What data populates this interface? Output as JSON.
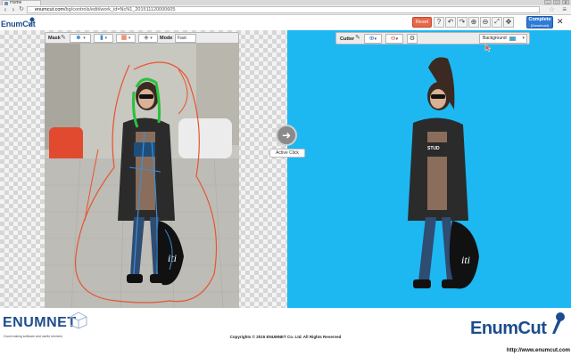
{
  "browser": {
    "tab_title": "Home",
    "url_host": "enumcut.com",
    "url_path": "/bg/controls/edit/work_id=NcN1_201511120000605",
    "window_buttons": [
      "–",
      "□",
      "✕"
    ]
  },
  "app": {
    "logo_text": "EnumCut",
    "reset_label": "Reset",
    "complete_label": "Complete",
    "complete_sub": "(Download)",
    "toolbar_icons": [
      "help-icon",
      "undo-icon",
      "redo-icon",
      "zoom-in-icon",
      "zoom-out-icon",
      "fit-icon",
      "move-icon"
    ]
  },
  "mask_toolbar": {
    "label": "Mask",
    "mode_label": "Mode",
    "mode_value": "Fast"
  },
  "cutter_toolbar": {
    "label": "Cutter",
    "background_label": "Background",
    "background_color": "#1db8f2"
  },
  "center": {
    "active_click": "Active Click"
  },
  "footer": {
    "company": "ENUMNET",
    "tagline": "Good making software and useful services",
    "copyright": "Copyrights © 2015 ENUMNET Co. Ltd. All Rights Reserved",
    "brand": "EnumCut",
    "site_url": "http://www.enumcut.com"
  },
  "colors": {
    "reset": "#e8684a",
    "complete": "#2f7cd6",
    "brand": "#1c4d8c",
    "cut_background": "#1db8f2",
    "mask_stroke_red": "#e8552e",
    "mask_stroke_blue": "#3a8fd8",
    "mask_stroke_green": "#28c23c"
  }
}
